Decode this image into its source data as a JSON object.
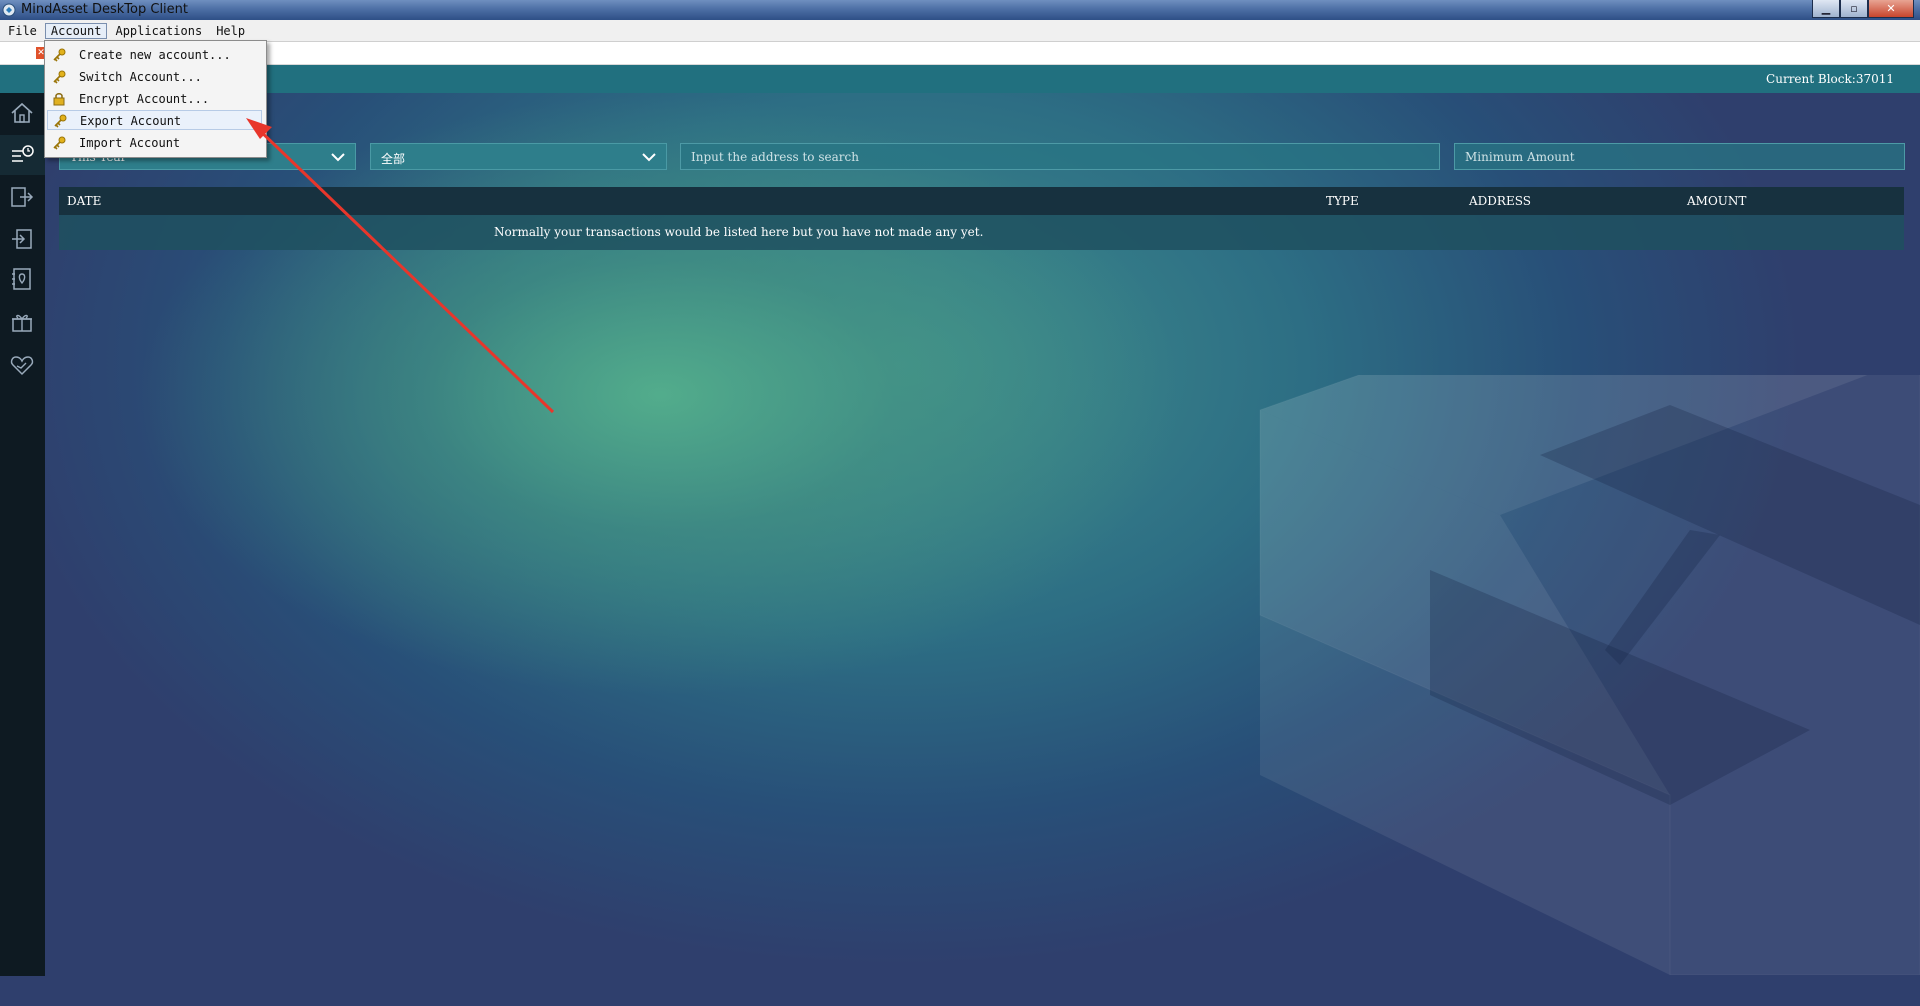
{
  "window": {
    "title": "MindAsset DeskTop Client",
    "controls": [
      "▁",
      "▫",
      "✕"
    ]
  },
  "menubar": {
    "items": [
      "File",
      "Account",
      "Applications",
      "Help"
    ],
    "active": "Account"
  },
  "account_menu": {
    "items": [
      {
        "label": "Create new account...",
        "icon": "key-icon"
      },
      {
        "label": "Switch Account...",
        "icon": "key-icon"
      },
      {
        "label": "Encrypt Account...",
        "icon": "lock-icon"
      },
      {
        "label": "Export Account",
        "icon": "key-icon"
      },
      {
        "label": "Import Account",
        "icon": "key-icon"
      }
    ],
    "highlighted": "Export Account"
  },
  "status": {
    "current_block": "Current Block:37011"
  },
  "filters": {
    "period": "This Year",
    "type": "全部",
    "address_placeholder": "Input the address to search",
    "amount_placeholder": "Minimum Amount"
  },
  "table": {
    "headers": {
      "date": "DATE",
      "type": "TYPE",
      "address": "ADDRESS",
      "amount": "AMOUNT"
    },
    "empty_message": "Normally your transactions would be listed here but you have not made any yet."
  },
  "sidebar": {
    "icons": [
      "home-icon",
      "transactions-icon",
      "send-icon",
      "receive-icon",
      "address-book-icon",
      "gift-icon",
      "donate-icon"
    ]
  },
  "colors": {
    "annotation_arrow": "#e8362b",
    "header_bg": "#17313f",
    "sidebar_bg": "#0e1a22"
  }
}
